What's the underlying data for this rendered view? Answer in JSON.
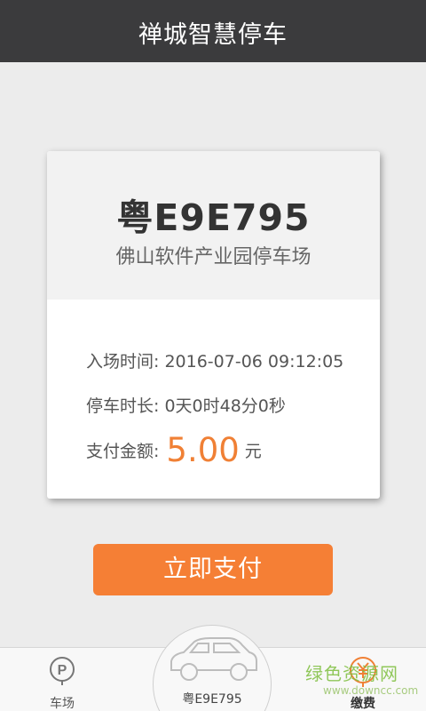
{
  "header": {
    "title": "禅城智慧停车"
  },
  "card": {
    "plate": "粤E9E795",
    "lot_name": "佛山软件产业园停车场",
    "entry_label": "入场时间:",
    "entry_time": "2016-07-06 09:12:05",
    "duration_label": "停车时长:",
    "duration": "0天0时48分0秒",
    "amount_label": "支付金额:",
    "amount": "5.00",
    "amount_unit": "元"
  },
  "actions": {
    "pay_label": "立即支付"
  },
  "tabbar": {
    "parking_label": "车场",
    "center_label": "粤E9E795",
    "fee_label": "缴费"
  },
  "watermark": {
    "text": "绿色资源网",
    "url": "www.downcc.com"
  },
  "colors": {
    "accent": "#f57f35",
    "topbar": "#3b3b3d",
    "amount": "#f08035"
  }
}
